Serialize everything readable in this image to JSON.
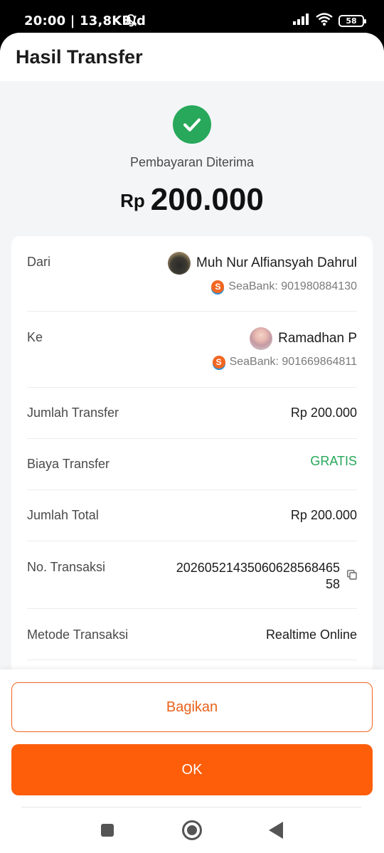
{
  "status_bar": {
    "time": "20:00 | 13,8KB/d",
    "battery": "58"
  },
  "header": {
    "title": "Hasil Transfer"
  },
  "result": {
    "status": "Pembayaran Diterima",
    "currency": "Rp",
    "amount": "200.000"
  },
  "details": {
    "from": {
      "label": "Dari",
      "name": "Muh Nur Alfiansyah Dahrul",
      "account": "SeaBank: 901980884130"
    },
    "to": {
      "label": "Ke",
      "name": "Ramadhan P",
      "account": "SeaBank: 901669864811"
    },
    "transfer_amount": {
      "label": "Jumlah Transfer",
      "value": "Rp 200.000"
    },
    "transfer_fee": {
      "label": "Biaya Transfer",
      "value": "GRATIS"
    },
    "total_amount": {
      "label": "Jumlah Total",
      "value": "Rp 200.000"
    },
    "transaction_no": {
      "label": "No. Transaksi",
      "value_line1": "20260521435060628568465",
      "value_line2": "58"
    },
    "method": {
      "label": "Metode Transaksi",
      "value": "Realtime Online"
    }
  },
  "actions": {
    "share_label": "Bagikan",
    "ok_label": "OK"
  },
  "colors": {
    "accent": "#fe5e0a",
    "success": "#27a85a"
  },
  "icons": {
    "success": "check-circle-icon",
    "bank": "seabank-logo-icon",
    "copy": "copy-icon"
  }
}
